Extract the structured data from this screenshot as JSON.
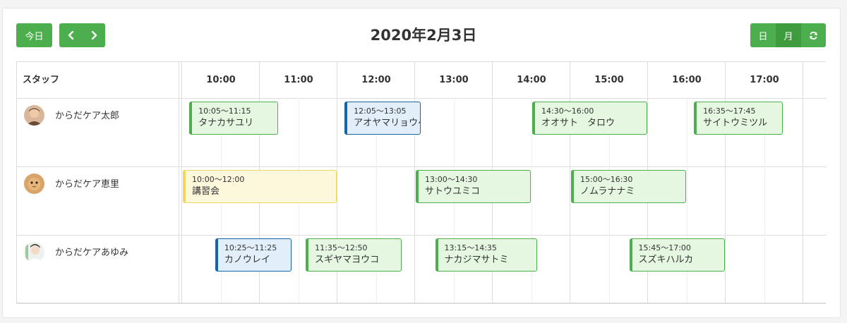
{
  "toolbar": {
    "today_label": "今日",
    "title": "2020年2月3日",
    "views": [
      {
        "label": "日",
        "active": true
      },
      {
        "label": "月",
        "active": false
      }
    ],
    "prev_icon": "chevron-left-icon",
    "next_icon": "chevron-right-icon",
    "refresh_icon": "refresh-icon"
  },
  "grid": {
    "resource_header": "スタッフ",
    "slots": [
      "10:00",
      "11:00",
      "12:00",
      "13:00",
      "14:00",
      "15:00",
      "16:00",
      "17:00"
    ]
  },
  "staff": [
    {
      "name": "からだケア太郎"
    },
    {
      "name": "からだケア恵里"
    },
    {
      "name": "からだケアあゆみ"
    }
  ],
  "events": [
    {
      "staff": 0,
      "time": "10:05〜11:15",
      "title": "タナカサユリ",
      "start": "10:05",
      "end": "11:15",
      "color": "green"
    },
    {
      "staff": 0,
      "time": "12:05〜13:05",
      "title": "アオヤマリョウヘイ",
      "start": "12:05",
      "end": "13:05",
      "color": "blue"
    },
    {
      "staff": 0,
      "time": "14:30〜16:00",
      "title": "オオサト　タロウ",
      "start": "14:30",
      "end": "16:00",
      "color": "green"
    },
    {
      "staff": 0,
      "time": "16:35〜17:45",
      "title": "サイトウミツル",
      "start": "16:35",
      "end": "17:45",
      "color": "green"
    },
    {
      "staff": 1,
      "time": "10:00〜12:00",
      "title": "講習会",
      "start": "10:00",
      "end": "12:00",
      "color": "yellow"
    },
    {
      "staff": 1,
      "time": "13:00〜14:30",
      "title": "サトウユミコ",
      "start": "13:00",
      "end": "14:30",
      "color": "green"
    },
    {
      "staff": 1,
      "time": "15:00〜16:30",
      "title": "ノムラナナミ",
      "start": "15:00",
      "end": "16:30",
      "color": "green"
    },
    {
      "staff": 2,
      "time": "10:25〜11:25",
      "title": "カノウレイ",
      "start": "10:25",
      "end": "11:25",
      "color": "blue"
    },
    {
      "staff": 2,
      "time": "11:35〜12:50",
      "title": "スギヤマヨウコ",
      "start": "11:35",
      "end": "12:50",
      "color": "green"
    },
    {
      "staff": 2,
      "time": "13:15〜14:35",
      "title": "ナカジマサトミ",
      "start": "13:15",
      "end": "14:35",
      "color": "green"
    },
    {
      "staff": 2,
      "time": "15:45〜17:00",
      "title": "スズキハルカ",
      "start": "15:45",
      "end": "17:00",
      "color": "green"
    }
  ],
  "colors": {
    "accent": "#4cae4c",
    "green_event_bg": "#e5f7e1",
    "blue_event_border": "#1565a7",
    "blue_event_bg": "#e2eef9",
    "yellow_event_border": "#f0d65e",
    "yellow_event_bg": "#fdf8dc"
  }
}
